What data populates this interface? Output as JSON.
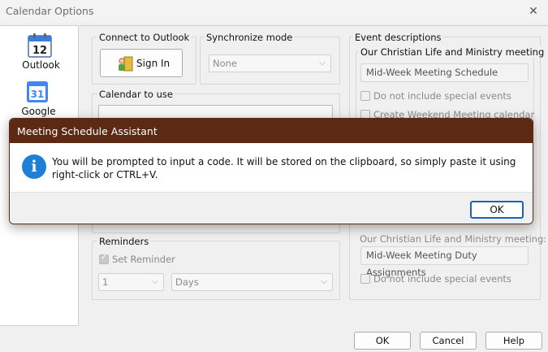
{
  "window": {
    "title": "Calendar Options",
    "close": "✕"
  },
  "nav": {
    "items": [
      {
        "label": "Outlook",
        "icon_day": "12"
      },
      {
        "label": "Google",
        "icon_day": "31"
      }
    ]
  },
  "connect": {
    "title": "Connect to Outlook",
    "sign_in": "Sign In"
  },
  "sync": {
    "title": "Synchronize mode",
    "value": "None"
  },
  "calendar": {
    "title": "Calendar to use"
  },
  "events": {
    "title": "Event descriptions",
    "section_title": "Our Christian Life and Ministry meeting",
    "midweek_schedule": "Mid-Week Meeting Schedule",
    "no_special_1": "Do not include special events",
    "create_weekend": "Create Weekend Meeting calendar",
    "duty_label": "Our Christian Life and Ministry meeting:",
    "duty_value": "Mid-Week Meeting Duty Assignments",
    "no_special_2": "Do not include special events"
  },
  "reminders": {
    "title": "Reminders",
    "set_reminder": "Set Reminder",
    "amount": "1",
    "unit": "Days"
  },
  "footer": {
    "ok": "OK",
    "cancel": "Cancel",
    "help": "Help"
  },
  "modal": {
    "title": "Meeting Schedule Assistant",
    "icon": "i",
    "message": "You will be prompted to input a code. It will be stored on the clipboard, so simply paste it using right-click or CTRL+V.",
    "ok": "OK"
  },
  "colors": {
    "modal_header": "#5c2a14",
    "info_icon": "#1f7fd6",
    "default_button_border": "#1b62b8"
  }
}
